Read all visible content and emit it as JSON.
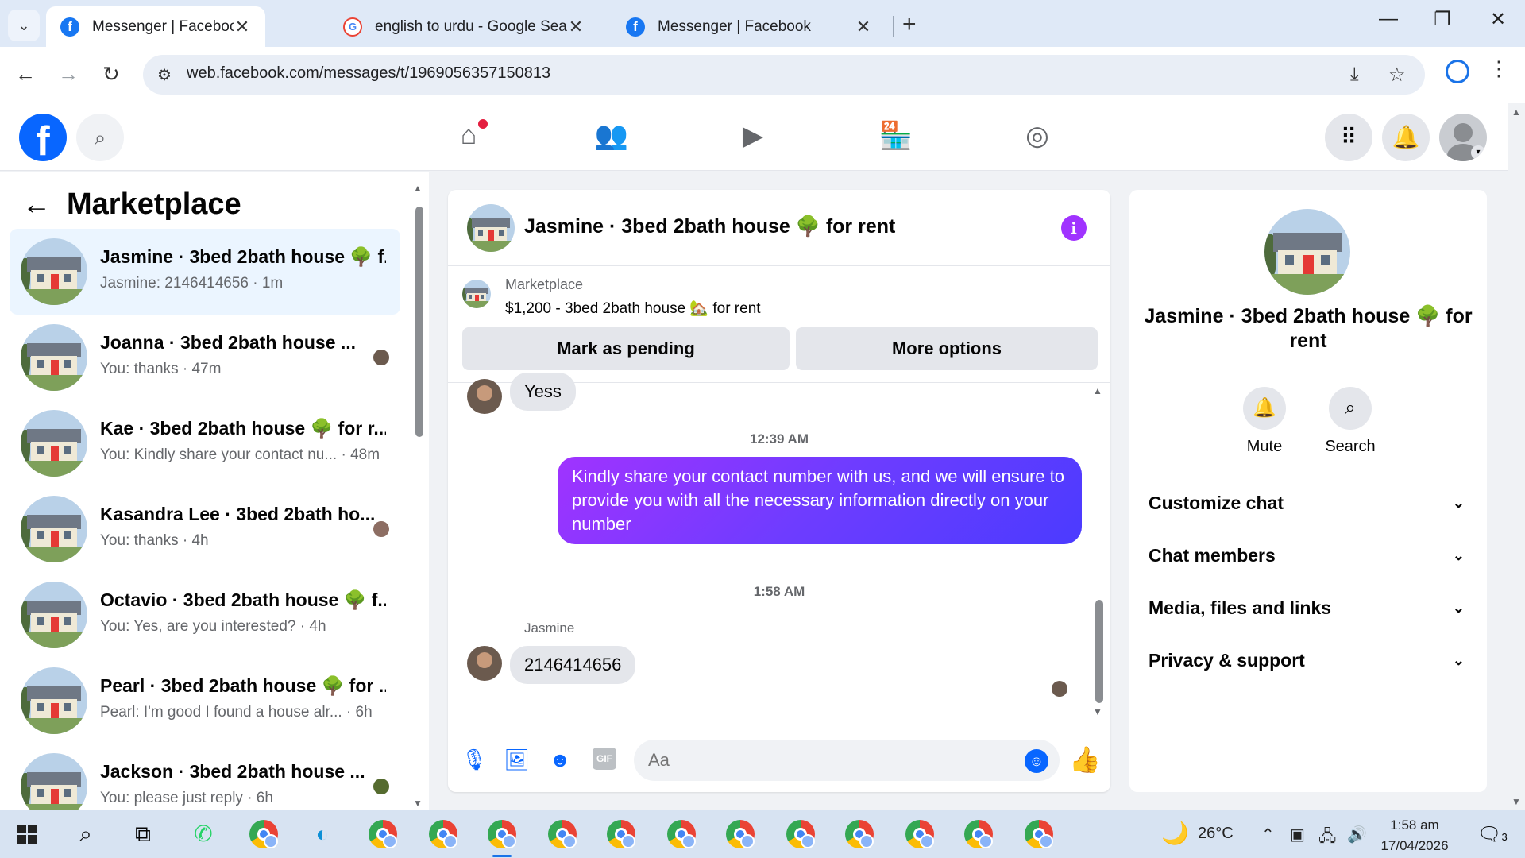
{
  "browser": {
    "tabs": [
      {
        "title": "Messenger | Facebook",
        "favicon": "facebook-icon",
        "active": true
      },
      {
        "title": "english to urdu - Google Search",
        "favicon": "google-icon",
        "active": false
      },
      {
        "title": "Messenger | Facebook",
        "favicon": "facebook-icon",
        "active": false
      }
    ],
    "url": "web.facebook.com/messages/t/1969056357150813"
  },
  "left_panel": {
    "title": "Marketplace",
    "conversations": [
      {
        "name": "Jasmine · 3bed 2bath house 🌳 f...",
        "preview": "Jasmine: 2146414656 · 1m",
        "active": true
      },
      {
        "name": "Joanna · 3bed 2bath house ...",
        "preview": "You: thanks · 47m",
        "active": false
      },
      {
        "name": "Kae · 3bed 2bath house 🌳 for r...",
        "preview": "You: Kindly share your contact nu... · 48m",
        "active": false
      },
      {
        "name": "Kasandra Lee · 3bed 2bath ho...",
        "preview": "You: thanks · 4h",
        "active": false
      },
      {
        "name": "Octavio · 3bed 2bath house 🌳 f...",
        "preview": "You: Yes, are you interested? · 4h",
        "active": false
      },
      {
        "name": "Pearl · 3bed 2bath house 🌳 for ...",
        "preview": "Pearl: I'm good I found a house alr... · 6h",
        "active": false
      },
      {
        "name": "Jackson · 3bed 2bath house ...",
        "preview": "You: please just reply · 6h",
        "active": false
      }
    ]
  },
  "chat": {
    "title": "Jasmine · 3bed 2bath house 🌳 for rent",
    "marketplace_source": "Marketplace",
    "product": "$1,200 - 3bed 2bath house 🏡 for rent",
    "mark_pending_label": "Mark as pending",
    "more_options_label": "More options",
    "messages": {
      "incoming_1": "Yess",
      "time_1": "12:39 AM",
      "outgoing_1": "Kindly share your contact number with us, and we will ensure to provide you with all the necessary information directly on your number",
      "time_2": "1:58 AM",
      "sender_name": "Jasmine",
      "incoming_2": "2146414656"
    },
    "composer_placeholder": "Aa"
  },
  "right_panel": {
    "name": "Jasmine · 3bed 2bath house 🌳 for rent",
    "mute_label": "Mute",
    "search_label": "Search",
    "sections": [
      "Customize chat",
      "Chat members",
      "Media, files and links",
      "Privacy & support"
    ]
  },
  "taskbar": {
    "temperature": "26°C",
    "time": "1:58 am",
    "date": "17/04/2026",
    "notification_count": "3"
  },
  "colors": {
    "fb_blue": "#0866ff",
    "messenger_gradient_start": "#a033ff",
    "messenger_gradient_end": "#4b3bff",
    "active_conversation_bg": "#ebf5ff"
  }
}
